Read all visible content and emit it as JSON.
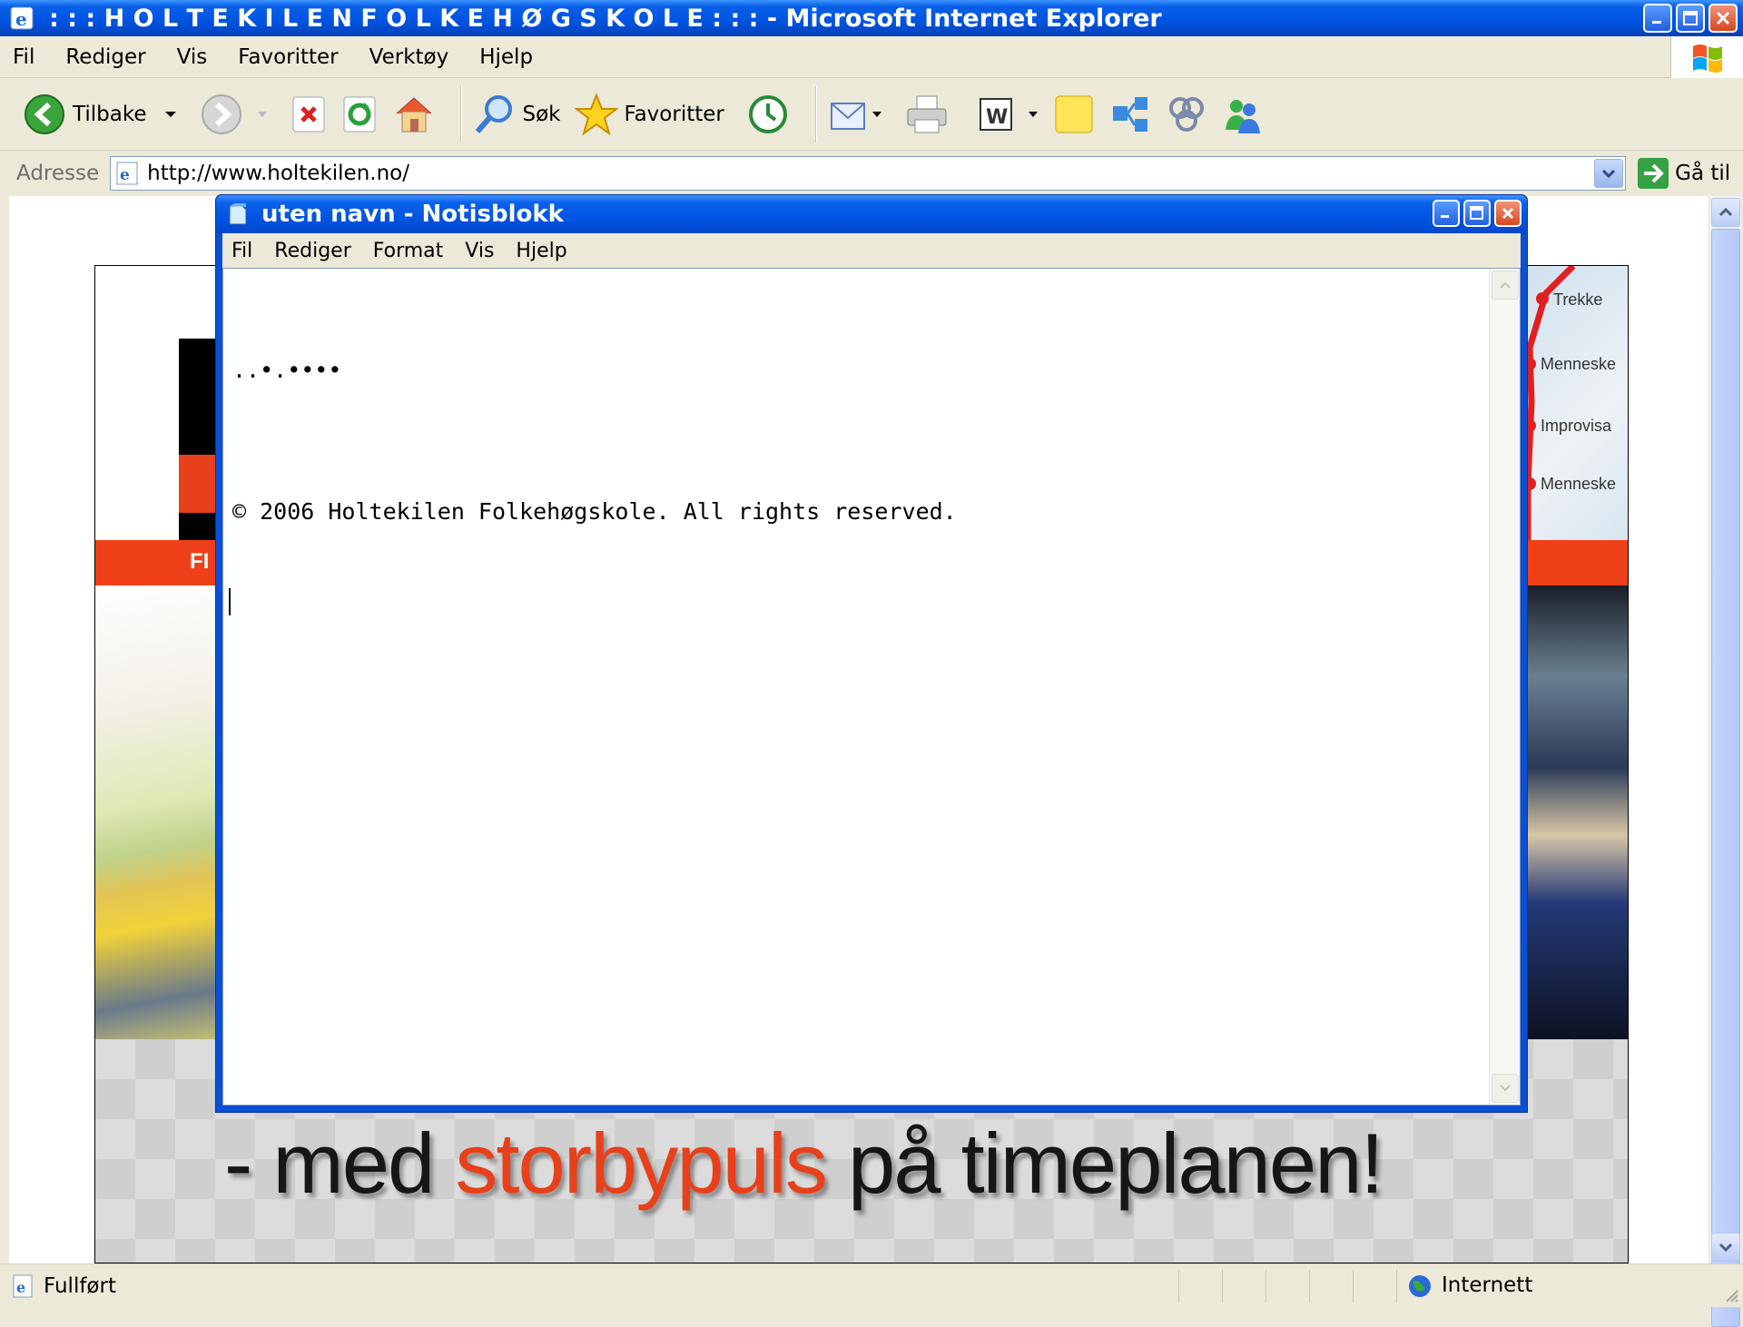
{
  "ie": {
    "title": ": : : H O L T E K I L E N  F O L K E H Ø G S K O L E : : : - Microsoft Internet Explorer",
    "menu": [
      "Fil",
      "Rediger",
      "Vis",
      "Favoritter",
      "Verktøy",
      "Hjelp"
    ],
    "toolbar": {
      "back": "Tilbake",
      "search": "Søk",
      "favorites": "Favoritter"
    },
    "address": {
      "label": "Adresse",
      "url": "http://www.holtekilen.no/",
      "go": "Gå til"
    },
    "status": {
      "left": "Fullført",
      "zone": "Internett"
    }
  },
  "webpage": {
    "nav_fragment": "FI",
    "map_labels": [
      "Trekke",
      "Menneske",
      "Improvisa",
      "Menneske"
    ],
    "slogan": {
      "part1": "- med ",
      "highlight": "storbypuls",
      "part2": " på timeplanen!"
    },
    "colors": {
      "accent_red": "#F0401A"
    }
  },
  "notepad": {
    "title": "uten navn - Notisblokk",
    "menu": [
      "Fil",
      "Rediger",
      "Format",
      "Vis",
      "Hjelp"
    ],
    "line_dots": "..•.••••",
    "line_copyright": "© 2006 Holtekilen Folkehøgskole. All rights reserved."
  }
}
